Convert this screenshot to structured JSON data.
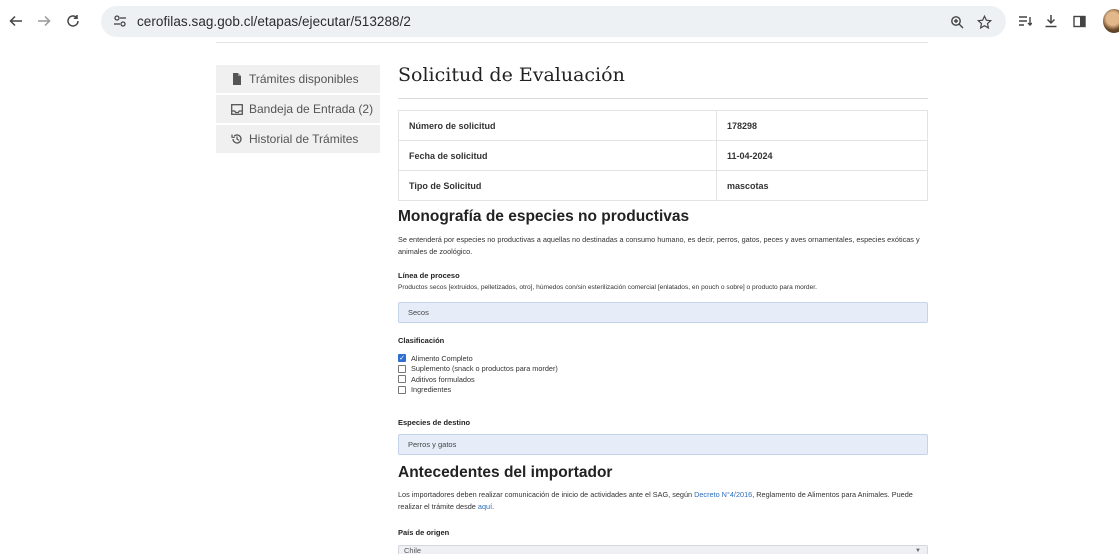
{
  "browser": {
    "url": "cerofilas.sag.gob.cl/etapas/ejecutar/513288/2"
  },
  "sidebar": {
    "items": [
      {
        "label": "Trámites disponibles"
      },
      {
        "label": "Bandeja de Entrada (2)"
      },
      {
        "label": "Historial de Trámites"
      }
    ]
  },
  "page": {
    "title": "Solicitud de Evaluación"
  },
  "info_table": [
    {
      "key": "Número de solicitud",
      "value": "178298"
    },
    {
      "key": "Fecha de solicitud",
      "value": "11-04-2024"
    },
    {
      "key": "Tipo de Solicitud",
      "value": "mascotas"
    }
  ],
  "monografia": {
    "title": "Monografía de especies no productivas",
    "description": "Se entenderá por especies no productivas a aquellas no destinadas a consumo humano, es decir, perros, gatos, peces y aves ornamentales, especies exóticas y animales de zoológico.",
    "linea": {
      "label": "Línea de proceso",
      "help": "Productos secos [extruidos, pelletizados, otro], húmedos con/sin esterilización comercial [enlatados, en pouch o sobre] o producto para morder.",
      "value": "Secos"
    },
    "clasificacion": {
      "label": "Clasificación",
      "options": [
        {
          "label": "Alimento Completo",
          "checked": true
        },
        {
          "label": "Suplemento (snack o productos para morder)",
          "checked": false
        },
        {
          "label": "Aditivos formulados",
          "checked": false
        },
        {
          "label": "Ingredientes",
          "checked": false
        }
      ]
    },
    "especies": {
      "label": "Especies de destino",
      "value": "Perros y gatos"
    }
  },
  "importador": {
    "title": "Antecedentes del importador",
    "text_before": "Los importadores deben realizar comunicación de inicio de actividades ante el SAG, según ",
    "link1": "Decreto N°4/2016",
    "text_middle": ", Reglamento de Alimentos para Animales. Puede realizar el trámite desde ",
    "link2": "aquí",
    "text_after": ".",
    "pais": {
      "label": "País de origen",
      "value": "Chile"
    }
  }
}
